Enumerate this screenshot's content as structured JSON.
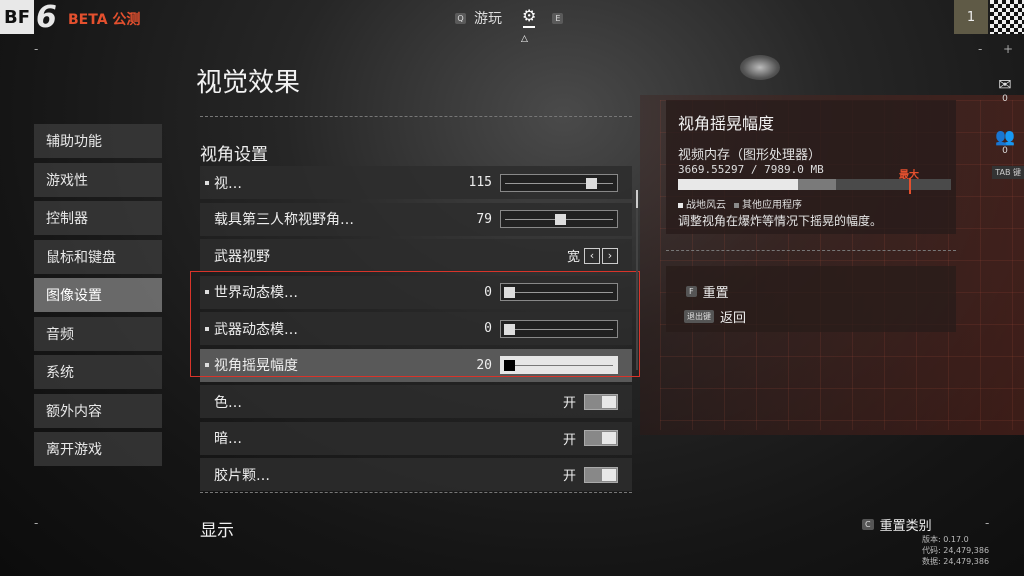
{
  "header": {
    "logo_bf": "BF",
    "logo_num": "6",
    "beta_label": "BETA 公测",
    "tab_left_key": "Q",
    "tab_game_label": "游玩",
    "tab_right_key": "E",
    "rank": "1"
  },
  "page_title": "视觉效果",
  "sidebar": {
    "items": [
      {
        "label": "辅助功能"
      },
      {
        "label": "游戏性"
      },
      {
        "label": "控制器"
      },
      {
        "label": "鼠标和键盘"
      },
      {
        "label": "图像设置"
      },
      {
        "label": "音频"
      },
      {
        "label": "系统"
      },
      {
        "label": "额外内容"
      },
      {
        "label": "离开游戏"
      }
    ],
    "active_index": 4
  },
  "section": {
    "title": "视角设置",
    "rows": [
      {
        "label": "视…",
        "value": "115",
        "slider": 0.83,
        "type": "slider"
      },
      {
        "label": "载具第三人称视野角…",
        "value": "79",
        "slider": 0.52,
        "type": "slider"
      },
      {
        "label": "武器视野",
        "value": "宽",
        "type": "select"
      },
      {
        "label": "世界动态模…",
        "value": "0",
        "slider": 0.0,
        "type": "slider"
      },
      {
        "label": "武器动态模…",
        "value": "0",
        "slider": 0.0,
        "type": "slider"
      },
      {
        "label": "视角摇晃幅度",
        "value": "20",
        "slider": 0.0,
        "type": "slider",
        "active": true
      },
      {
        "label": "色…",
        "value": "开",
        "type": "toggle"
      },
      {
        "label": "暗…",
        "value": "开",
        "type": "toggle"
      },
      {
        "label": "胶片颗…",
        "value": "开",
        "type": "toggle"
      }
    ]
  },
  "display_title": "显示",
  "info": {
    "title": "视角摇晃幅度",
    "vram_label": "视频内存（图形处理器）",
    "vram_value": "3669.55297 / 7989.0 MB",
    "vram_bf_fraction": 0.44,
    "vram_other_fraction": 0.14,
    "max_label": "最大",
    "legend_bf": "战地风云",
    "legend_other": "其他应用程序",
    "description": "调整视角在爆炸等情况下摇晃的幅度。"
  },
  "actions": {
    "reset_key": "F",
    "reset_label": "重置",
    "back_key": "退出键",
    "back_label": "返回"
  },
  "side_icons": {
    "mail_count": "0",
    "friends_count": "0",
    "tab_key": "TAB 键"
  },
  "footer": {
    "reset_category_key": "C",
    "reset_category_label": "重置类别",
    "version": "版本: 0.17.0",
    "code": "代码: 24,479,386",
    "data": "数据: 24,479,386"
  },
  "colors": {
    "accent": "#e4502e",
    "highlight_border": "#d8342a"
  }
}
